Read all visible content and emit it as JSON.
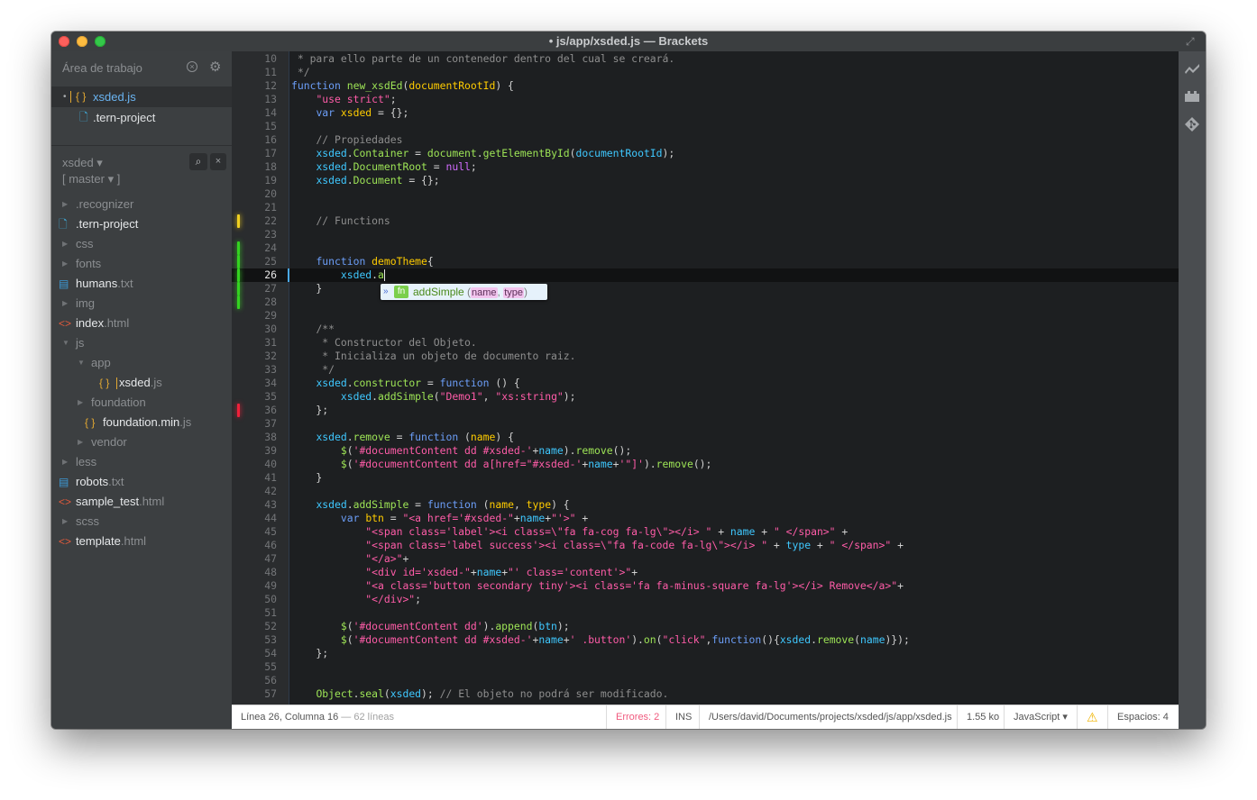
{
  "window": {
    "title": "• js/app/xsded.js — Brackets"
  },
  "working_set": {
    "header": "Área de trabajo",
    "items": [
      {
        "dot": "•",
        "icon": "{ }",
        "name": "xsded.js",
        "selected": true
      },
      {
        "icon": "document-icon",
        "name": ".tern-project",
        "selected": false
      }
    ]
  },
  "project": {
    "name": "xsded ▾",
    "branch": "[ master ▾ ]",
    "tree": [
      {
        "type": "folder",
        "name": ".recognizer",
        "depth": 0,
        "open": false
      },
      {
        "type": "file",
        "icon": "doc",
        "base": ".tern-project",
        "ext": "",
        "depth": 0
      },
      {
        "type": "folder",
        "name": "css",
        "depth": 0,
        "open": false
      },
      {
        "type": "folder",
        "name": "fonts",
        "depth": 0,
        "open": false
      },
      {
        "type": "file",
        "icon": "txt",
        "base": "humans",
        "ext": ".txt",
        "depth": 0
      },
      {
        "type": "folder",
        "name": "img",
        "depth": 0,
        "open": false
      },
      {
        "type": "file",
        "icon": "html",
        "base": "index",
        "ext": ".html",
        "depth": 0
      },
      {
        "type": "folder",
        "name": "js",
        "depth": 0,
        "open": true
      },
      {
        "type": "folder",
        "name": "app",
        "depth": 1,
        "open": true
      },
      {
        "type": "file",
        "icon": "js",
        "base": "xsded",
        "ext": ".js",
        "depth": 2,
        "active": true
      },
      {
        "type": "folder",
        "name": "foundation",
        "depth": 1,
        "open": false
      },
      {
        "type": "file",
        "icon": "js",
        "base": "foundation.min",
        "ext": ".js",
        "depth": 1
      },
      {
        "type": "folder",
        "name": "vendor",
        "depth": 1,
        "open": false
      },
      {
        "type": "folder",
        "name": "less",
        "depth": 0,
        "open": false
      },
      {
        "type": "file",
        "icon": "txt",
        "base": "robots",
        "ext": ".txt",
        "depth": 0
      },
      {
        "type": "file",
        "icon": "html",
        "base": "sample_test",
        "ext": ".html",
        "depth": 0
      },
      {
        "type": "folder",
        "name": "scss",
        "depth": 0,
        "open": false
      },
      {
        "type": "file",
        "icon": "html",
        "base": "template",
        "ext": ".html",
        "depth": 0
      }
    ]
  },
  "editor": {
    "active_line": 26,
    "gutter_marks": {
      "22": "yellow",
      "24": "green",
      "25": "green",
      "26": "green",
      "27": "green",
      "28": "green",
      "36": "red"
    },
    "lines": [
      {
        "n": 10,
        "t": [
          [
            "cm",
            " * para ello parte de un contenedor dentro del cual se creará."
          ]
        ]
      },
      {
        "n": 11,
        "t": [
          [
            "cm",
            " */"
          ]
        ]
      },
      {
        "n": 12,
        "t": [
          [
            "kw",
            "function "
          ],
          [
            "fn",
            "new_xsdEd"
          ],
          [
            "def",
            "("
          ],
          [
            "param",
            "documentRootId"
          ],
          [
            "def",
            ") {"
          ]
        ]
      },
      {
        "n": 13,
        "t": [
          [
            "def",
            "    "
          ],
          [
            "str",
            "\"use strict\""
          ],
          [
            "def",
            ";"
          ]
        ]
      },
      {
        "n": 14,
        "t": [
          [
            "def",
            "    "
          ],
          [
            "kw",
            "var "
          ],
          [
            "var",
            "xsded"
          ],
          [
            "def",
            " = {};"
          ]
        ]
      },
      {
        "n": 15,
        "t": []
      },
      {
        "n": 16,
        "t": [
          [
            "def",
            "    "
          ],
          [
            "cm",
            "// Propiedades"
          ]
        ]
      },
      {
        "n": 17,
        "t": [
          [
            "def",
            "    "
          ],
          [
            "obj",
            "xsded"
          ],
          [
            "def",
            "."
          ],
          [
            "prop",
            "Container"
          ],
          [
            "def",
            " = "
          ],
          [
            "prop",
            "document"
          ],
          [
            "def",
            "."
          ],
          [
            "prop",
            "getElementById"
          ],
          [
            "def",
            "("
          ],
          [
            "obj",
            "documentRootId"
          ],
          [
            "def",
            ");"
          ]
        ]
      },
      {
        "n": 18,
        "t": [
          [
            "def",
            "    "
          ],
          [
            "obj",
            "xsded"
          ],
          [
            "def",
            "."
          ],
          [
            "prop",
            "DocumentRoot"
          ],
          [
            "def",
            " = "
          ],
          [
            "null",
            "null"
          ],
          [
            "def",
            ";"
          ]
        ]
      },
      {
        "n": 19,
        "t": [
          [
            "def",
            "    "
          ],
          [
            "obj",
            "xsded"
          ],
          [
            "def",
            "."
          ],
          [
            "prop",
            "Document"
          ],
          [
            "def",
            " = {};"
          ]
        ]
      },
      {
        "n": 20,
        "t": []
      },
      {
        "n": 21,
        "t": []
      },
      {
        "n": 22,
        "t": [
          [
            "def",
            "    "
          ],
          [
            "cm",
            "// Functions"
          ]
        ]
      },
      {
        "n": 23,
        "t": []
      },
      {
        "n": 24,
        "t": []
      },
      {
        "n": 25,
        "t": [
          [
            "def",
            "    "
          ],
          [
            "kw",
            "function "
          ],
          [
            "var",
            "demoTheme"
          ],
          [
            "def",
            "{"
          ]
        ]
      },
      {
        "n": 26,
        "t": [
          [
            "def",
            "        "
          ],
          [
            "obj",
            "xsded"
          ],
          [
            "def",
            "."
          ],
          [
            "prop",
            "a"
          ]
        ],
        "cursor": true
      },
      {
        "n": 27,
        "t": [
          [
            "def",
            "    }"
          ]
        ]
      },
      {
        "n": 28,
        "t": []
      },
      {
        "n": 29,
        "t": []
      },
      {
        "n": 30,
        "t": [
          [
            "def",
            "    "
          ],
          [
            "cm",
            "/**"
          ]
        ]
      },
      {
        "n": 31,
        "t": [
          [
            "def",
            "    "
          ],
          [
            "cm",
            " * Constructor del Objeto."
          ]
        ]
      },
      {
        "n": 32,
        "t": [
          [
            "def",
            "    "
          ],
          [
            "cm",
            " * Inicializa un objeto de documento raiz."
          ]
        ]
      },
      {
        "n": 33,
        "t": [
          [
            "def",
            "    "
          ],
          [
            "cm",
            " */"
          ]
        ]
      },
      {
        "n": 34,
        "t": [
          [
            "def",
            "    "
          ],
          [
            "obj",
            "xsded"
          ],
          [
            "def",
            "."
          ],
          [
            "prop",
            "constructor"
          ],
          [
            "def",
            " = "
          ],
          [
            "kw",
            "function"
          ],
          [
            "def",
            " () {"
          ]
        ]
      },
      {
        "n": 35,
        "t": [
          [
            "def",
            "        "
          ],
          [
            "obj",
            "xsded"
          ],
          [
            "def",
            "."
          ],
          [
            "prop",
            "addSimple"
          ],
          [
            "def",
            "("
          ],
          [
            "str",
            "\"Demo1\""
          ],
          [
            "def",
            ", "
          ],
          [
            "str",
            "\"xs:string\""
          ],
          [
            "def",
            ");"
          ]
        ]
      },
      {
        "n": 36,
        "t": [
          [
            "def",
            "    };"
          ]
        ]
      },
      {
        "n": 37,
        "t": []
      },
      {
        "n": 38,
        "t": [
          [
            "def",
            "    "
          ],
          [
            "obj",
            "xsded"
          ],
          [
            "def",
            "."
          ],
          [
            "prop",
            "remove"
          ],
          [
            "def",
            " = "
          ],
          [
            "kw",
            "function"
          ],
          [
            "def",
            " ("
          ],
          [
            "param",
            "name"
          ],
          [
            "def",
            ") {"
          ]
        ]
      },
      {
        "n": 39,
        "t": [
          [
            "def",
            "        "
          ],
          [
            "fn",
            "$"
          ],
          [
            "def",
            "("
          ],
          [
            "str",
            "'#documentContent dd #xsded-'"
          ],
          [
            "def",
            "+"
          ],
          [
            "pl",
            "name"
          ],
          [
            "def",
            ")."
          ],
          [
            "prop",
            "remove"
          ],
          [
            "def",
            "();"
          ]
        ]
      },
      {
        "n": 40,
        "t": [
          [
            "def",
            "        "
          ],
          [
            "fn",
            "$"
          ],
          [
            "def",
            "("
          ],
          [
            "str",
            "'#documentContent dd a[href=\"#xsded-'"
          ],
          [
            "def",
            "+"
          ],
          [
            "pl",
            "name"
          ],
          [
            "def",
            "+"
          ],
          [
            "str",
            "'\"]'"
          ],
          [
            "def",
            ")."
          ],
          [
            "prop",
            "remove"
          ],
          [
            "def",
            "();"
          ]
        ]
      },
      {
        "n": 41,
        "t": [
          [
            "def",
            "    }"
          ]
        ]
      },
      {
        "n": 42,
        "t": []
      },
      {
        "n": 43,
        "t": [
          [
            "def",
            "    "
          ],
          [
            "obj",
            "xsded"
          ],
          [
            "def",
            "."
          ],
          [
            "prop",
            "addSimple"
          ],
          [
            "def",
            " = "
          ],
          [
            "kw",
            "function"
          ],
          [
            "def",
            " ("
          ],
          [
            "param",
            "name"
          ],
          [
            "def",
            ", "
          ],
          [
            "param",
            "type"
          ],
          [
            "def",
            ") {"
          ]
        ]
      },
      {
        "n": 44,
        "t": [
          [
            "def",
            "        "
          ],
          [
            "kw",
            "var "
          ],
          [
            "var",
            "btn"
          ],
          [
            "def",
            " = "
          ],
          [
            "str",
            "\"<a href='#xsded-\""
          ],
          [
            "def",
            "+"
          ],
          [
            "pl",
            "name"
          ],
          [
            "def",
            "+"
          ],
          [
            "str",
            "\"'>\""
          ],
          [
            "def",
            " +"
          ]
        ]
      },
      {
        "n": 45,
        "t": [
          [
            "def",
            "            "
          ],
          [
            "str",
            "\"<span class='label'><i class=\\\"fa fa-cog fa-lg\\\"></i> \""
          ],
          [
            "def",
            " + "
          ],
          [
            "pl",
            "name"
          ],
          [
            "def",
            " + "
          ],
          [
            "str",
            "\" </span>\""
          ],
          [
            "def",
            " +"
          ]
        ]
      },
      {
        "n": 46,
        "t": [
          [
            "def",
            "            "
          ],
          [
            "str",
            "\"<span class='label success'><i class=\\\"fa fa-code fa-lg\\\"></i> \""
          ],
          [
            "def",
            " + "
          ],
          [
            "pl",
            "type"
          ],
          [
            "def",
            " + "
          ],
          [
            "str",
            "\" </span>\""
          ],
          [
            "def",
            " +"
          ]
        ]
      },
      {
        "n": 47,
        "t": [
          [
            "def",
            "            "
          ],
          [
            "str",
            "\"</a>\""
          ],
          [
            "def",
            "+"
          ]
        ]
      },
      {
        "n": 48,
        "t": [
          [
            "def",
            "            "
          ],
          [
            "str",
            "\"<div id='xsded-\""
          ],
          [
            "def",
            "+"
          ],
          [
            "pl",
            "name"
          ],
          [
            "def",
            "+"
          ],
          [
            "str",
            "\"' class='content'>\""
          ],
          [
            "def",
            "+"
          ]
        ]
      },
      {
        "n": 49,
        "t": [
          [
            "def",
            "            "
          ],
          [
            "str",
            "\"<a class='button secondary tiny'><i class='fa fa-minus-square fa-lg'></i> Remove</a>\""
          ],
          [
            "def",
            "+"
          ]
        ]
      },
      {
        "n": 50,
        "t": [
          [
            "def",
            "            "
          ],
          [
            "str",
            "\"</div>\""
          ],
          [
            "def",
            ";"
          ]
        ]
      },
      {
        "n": 51,
        "t": []
      },
      {
        "n": 52,
        "t": [
          [
            "def",
            "        "
          ],
          [
            "fn",
            "$"
          ],
          [
            "def",
            "("
          ],
          [
            "str",
            "'#documentContent dd'"
          ],
          [
            "def",
            ")."
          ],
          [
            "prop",
            "append"
          ],
          [
            "def",
            "("
          ],
          [
            "pl",
            "btn"
          ],
          [
            "def",
            ");"
          ]
        ]
      },
      {
        "n": 53,
        "t": [
          [
            "def",
            "        "
          ],
          [
            "fn",
            "$"
          ],
          [
            "def",
            "("
          ],
          [
            "str",
            "'#documentContent dd #xsded-'"
          ],
          [
            "def",
            "+"
          ],
          [
            "pl",
            "name"
          ],
          [
            "def",
            "+"
          ],
          [
            "str",
            "' .button'"
          ],
          [
            "def",
            ")."
          ],
          [
            "prop",
            "on"
          ],
          [
            "def",
            "("
          ],
          [
            "str",
            "\"click\""
          ],
          [
            "def",
            ","
          ],
          [
            "kw",
            "function"
          ],
          [
            "def",
            "(){"
          ],
          [
            "obj",
            "xsded"
          ],
          [
            "def",
            "."
          ],
          [
            "prop",
            "remove"
          ],
          [
            "def",
            "("
          ],
          [
            "pl",
            "name"
          ],
          [
            "def",
            ")});"
          ]
        ]
      },
      {
        "n": 54,
        "t": [
          [
            "def",
            "    };"
          ]
        ]
      },
      {
        "n": 55,
        "t": []
      },
      {
        "n": 56,
        "t": []
      },
      {
        "n": 57,
        "t": [
          [
            "def",
            "    "
          ],
          [
            "prop",
            "Object"
          ],
          [
            "def",
            "."
          ],
          [
            "prop",
            "seal"
          ],
          [
            "def",
            "("
          ],
          [
            "obj",
            "xsded"
          ],
          [
            "def",
            "); "
          ],
          [
            "cm",
            "// El objeto no podrá ser modificado."
          ]
        ]
      }
    ],
    "code_hint": {
      "selector": "»",
      "badge": "fn",
      "name": "addSimple",
      "open": "(",
      "args": [
        "name",
        "type"
      ],
      "sep": ", ",
      "close": ")"
    }
  },
  "statusbar": {
    "position": "Línea 26, Columna 16",
    "lines_count": " — 62 líneas",
    "errors": "Errores: 2",
    "mode": "INS",
    "path": "/Users/david/Documents/projects/xsded/js/app/xsded.js",
    "size": "1.55 ko",
    "language": "JavaScript ▾",
    "warning": "⚠",
    "indent": "Espacios:  4"
  },
  "right_toolbar": {
    "icons": [
      "live-preview-icon",
      "extension-manager-icon",
      "git-icon"
    ]
  }
}
